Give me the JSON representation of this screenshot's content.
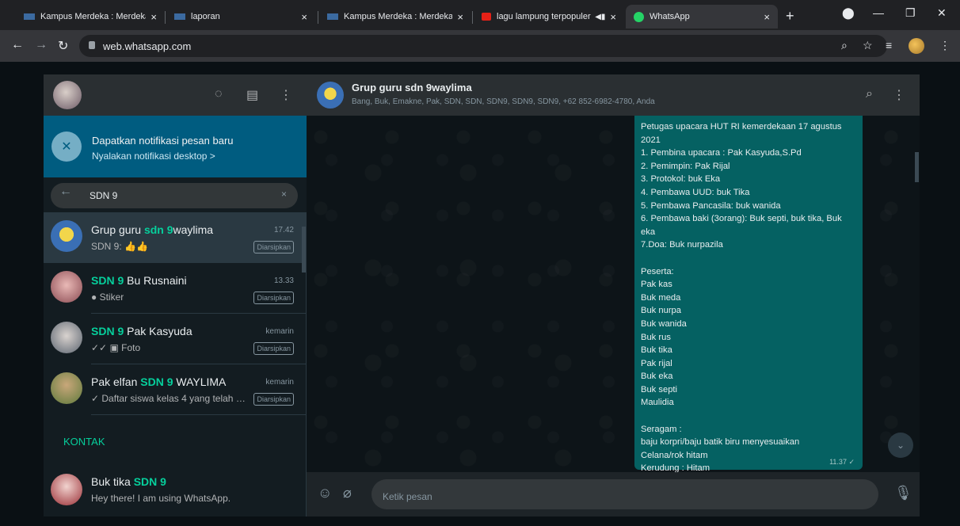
{
  "browser": {
    "tabs": [
      {
        "title": "Kampus Merdeka : Merdeka I",
        "active": false
      },
      {
        "title": "laporan",
        "active": false
      },
      {
        "title": "Kampus Merdeka : Merdeka I",
        "active": false
      },
      {
        "title": "lagu lampung terpopuler",
        "active": false
      },
      {
        "title": "WhatsApp",
        "active": true
      }
    ],
    "tab_close": "×",
    "new_tab": "+",
    "url": "web.whatsapp.com",
    "icons": [
      "back-icon",
      "forward-icon",
      "reload-icon",
      "lock-icon",
      "zoom-icon",
      "star-icon",
      "media-icon",
      "profile-icon",
      "menu-icon",
      "minimize-icon",
      "maximize-icon",
      "close-icon"
    ]
  },
  "sidebar": {
    "notification": {
      "title": "Dapatkan notifikasi pesan baru",
      "subtitle": "Nyalakan notifikasi desktop >"
    },
    "search": {
      "value": "SDN 9",
      "clear": "×"
    },
    "chats": [
      {
        "name_prefix": "Grup guru ",
        "name_hl": "sdn 9",
        "name_suffix": "waylima",
        "time": "17.42",
        "preview": "SDN 9: 👍👍",
        "badge": "Diarsipkan",
        "selected": true
      },
      {
        "name_prefix": "",
        "name_hl": "SDN 9",
        "name_suffix": " Bu Rusnaini",
        "time": "13.33",
        "preview": "● Stiker",
        "badge": "Diarsipkan",
        "selected": false
      },
      {
        "name_prefix": "",
        "name_hl": "SDN 9",
        "name_suffix": " Pak Kasyuda",
        "time": "kemarin",
        "preview": "✓✓ ▣ Foto",
        "badge": "Diarsipkan",
        "selected": false
      },
      {
        "name_prefix": "Pak elfan ",
        "name_hl": "SDN 9",
        "name_suffix": " WAYLIMA",
        "time": "kemarin",
        "preview": "✓ Daftar siswa kelas 4 yang telah men...",
        "badge": "Diarsipkan",
        "selected": false
      }
    ],
    "section_contacts": "KONTAK",
    "contact": {
      "name_prefix": "Buk tika ",
      "name_hl": "SDN 9",
      "status": "Hey there! I am using WhatsApp."
    }
  },
  "conversation": {
    "group_name": "Grup guru sdn 9waylima",
    "members": "Bang, Buk, Emakne, Pak, SDN, SDN, SDN9, SDN9, SDN9, +62 852-6982-4780, Anda",
    "message": "Petugas upacara HUT RI kemerdekaan 17 agustus 2021\n1. Pembina upacara : Pak Kasyuda,S.Pd\n2. Pemimpin: Pak Rijal\n3. Protokol: buk Eka\n4. Pembawa UUD: buk Tika\n5. Pembawa Pancasila: buk wanida\n6. Pembawa baki (3orang): Buk septi, buk tika, Buk eka\n7.Doa: Buk nurpazila\n\nPeserta:\nPak kas\nBuk meda\nBuk nurpa\nBuk wanida\nBuk rus\nBuk tika\nPak rijal\nBuk eka\nBuk septi\nMaulidia\n\nSeragam :\nbaju korpri/baju batik biru menyesuaikan\nCelana/rok hitam\nKerudung : Hitam\nMasker : Free dr maulidia",
    "message_time": "11.37 ✓",
    "input_placeholder": "Ketik pesan"
  },
  "colors": {
    "accent": "#06cf9c",
    "bubble": "#056162",
    "notif_bg": "#005c80"
  }
}
